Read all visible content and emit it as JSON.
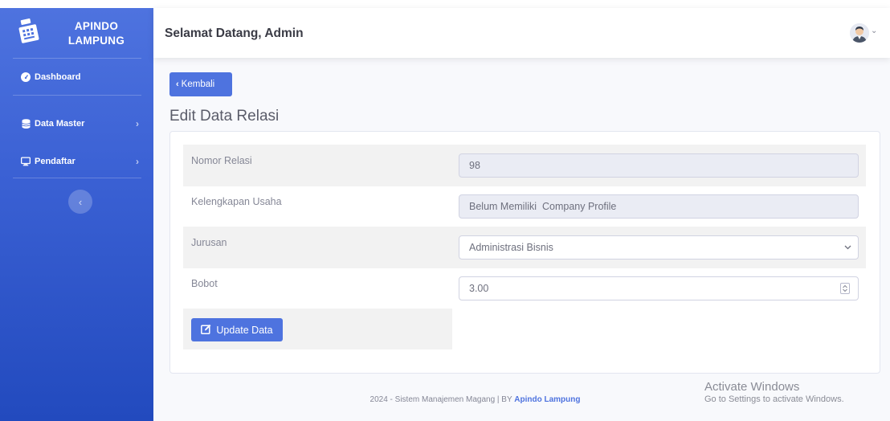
{
  "sidebar": {
    "brand_line1": "APINDO",
    "brand_line2": "LAMPUNG",
    "brand_icon": "cash-register-icon",
    "items": [
      {
        "label": "Dashboard",
        "icon": "tachometer-icon"
      },
      {
        "label": "Data Master",
        "icon": "database-icon",
        "chevron": "›"
      },
      {
        "label": "Pendaftar",
        "icon": "desktop-icon",
        "chevron": "›"
      }
    ],
    "toggle": "‹"
  },
  "topbar": {
    "welcome": "Selamat Datang, Admin",
    "avatar_icon": "user-avatar-icon",
    "caret": "⌄"
  },
  "main": {
    "back_label": "Kembali",
    "back_chevron": "‹",
    "title": "Edit Data Relasi",
    "form": {
      "nomor_relasi_label": "Nomor Relasi",
      "nomor_relasi_value": "98",
      "kelengkapan_label": "Kelengkapan Usaha",
      "kelengkapan_value": "Belum Memiliki  Company Profile",
      "jurusan_label": "Jurusan",
      "jurusan_value": "Administrasi Bisnis",
      "bobot_label": "Bobot",
      "bobot_value": "3.00"
    },
    "update_label": "Update Data"
  },
  "watermark": {
    "line1": "Activate Windows",
    "line2": "Go to Settings to activate Windows."
  },
  "footer": {
    "text": "2024 - Sistem Manajemen Magang | BY ",
    "brand": "Apindo Lampung"
  },
  "colors": {
    "primary": "#4e73df",
    "sidebar_dark": "#224abe",
    "text_muted": "#858796"
  }
}
